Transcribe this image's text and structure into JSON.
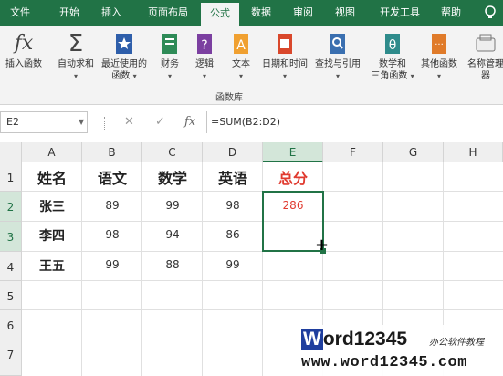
{
  "ribbon_tabs": [
    "文件",
    "开始",
    "插入",
    "页面布局",
    "公式",
    "数据",
    "审阅",
    "视图",
    "开发工具",
    "帮助"
  ],
  "active_tab": "公式",
  "search_icon": "lightbulb-icon",
  "ribbon": {
    "insert_function": "插入函数",
    "autosum": "自动求和",
    "recent": "最近使用的函数",
    "financial": "财务",
    "logical": "逻辑",
    "text": "文本",
    "datetime": "日期和时间",
    "lookup": "查找与引用",
    "math_line1": "数学和",
    "math_line2": "三角函数",
    "other": "其他函数",
    "name_mgr": "名称管理器",
    "group_label": "函数库"
  },
  "formula_bar": {
    "name_box": "E2",
    "fx": "fx",
    "formula": "=SUM(B2:D2)"
  },
  "columns": [
    "A",
    "B",
    "C",
    "D",
    "E",
    "F",
    "G",
    "H"
  ],
  "rows": [
    "1",
    "2",
    "3",
    "4",
    "5",
    "6",
    "7"
  ],
  "selected_column": "E",
  "selected_rows": [
    "2",
    "3"
  ],
  "table": {
    "headers": [
      "姓名",
      "语文",
      "数学",
      "英语",
      "总分"
    ],
    "rows": [
      [
        "张三",
        "89",
        "99",
        "98",
        "286"
      ],
      [
        "李四",
        "98",
        "94",
        "86",
        ""
      ],
      [
        "王五",
        "99",
        "88",
        "99",
        ""
      ]
    ]
  },
  "colors": {
    "excel_green": "#217346",
    "total_red": "#e03a2f",
    "watermark_blue": "#1f3e9e"
  },
  "watermark": {
    "brand_w": "W",
    "brand_rest": "ord12345",
    "tagline": "办公软件教程",
    "url": "www.word12345.com"
  }
}
